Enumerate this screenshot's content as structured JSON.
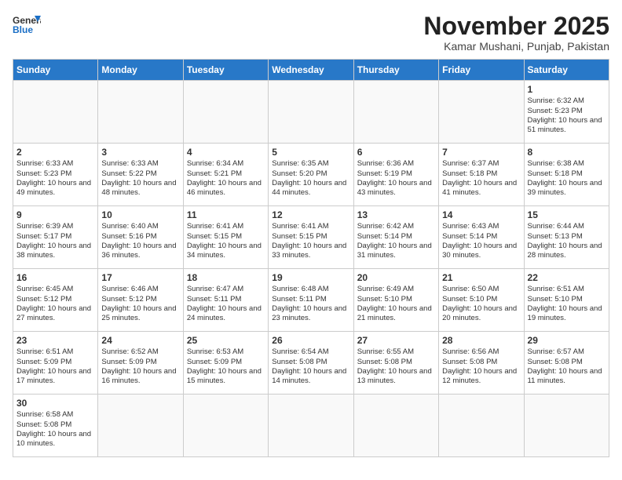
{
  "header": {
    "logo_general": "General",
    "logo_blue": "Blue",
    "title": "November 2025",
    "subtitle": "Kamar Mushani, Punjab, Pakistan"
  },
  "days_of_week": [
    "Sunday",
    "Monday",
    "Tuesday",
    "Wednesday",
    "Thursday",
    "Friday",
    "Saturday"
  ],
  "weeks": [
    [
      {
        "day": "",
        "info": ""
      },
      {
        "day": "",
        "info": ""
      },
      {
        "day": "",
        "info": ""
      },
      {
        "day": "",
        "info": ""
      },
      {
        "day": "",
        "info": ""
      },
      {
        "day": "",
        "info": ""
      },
      {
        "day": "1",
        "info": "Sunrise: 6:32 AM\nSunset: 5:23 PM\nDaylight: 10 hours and 51 minutes."
      }
    ],
    [
      {
        "day": "2",
        "info": "Sunrise: 6:33 AM\nSunset: 5:23 PM\nDaylight: 10 hours and 49 minutes."
      },
      {
        "day": "3",
        "info": "Sunrise: 6:33 AM\nSunset: 5:22 PM\nDaylight: 10 hours and 48 minutes."
      },
      {
        "day": "4",
        "info": "Sunrise: 6:34 AM\nSunset: 5:21 PM\nDaylight: 10 hours and 46 minutes."
      },
      {
        "day": "5",
        "info": "Sunrise: 6:35 AM\nSunset: 5:20 PM\nDaylight: 10 hours and 44 minutes."
      },
      {
        "day": "6",
        "info": "Sunrise: 6:36 AM\nSunset: 5:19 PM\nDaylight: 10 hours and 43 minutes."
      },
      {
        "day": "7",
        "info": "Sunrise: 6:37 AM\nSunset: 5:18 PM\nDaylight: 10 hours and 41 minutes."
      },
      {
        "day": "8",
        "info": "Sunrise: 6:38 AM\nSunset: 5:18 PM\nDaylight: 10 hours and 39 minutes."
      }
    ],
    [
      {
        "day": "9",
        "info": "Sunrise: 6:39 AM\nSunset: 5:17 PM\nDaylight: 10 hours and 38 minutes."
      },
      {
        "day": "10",
        "info": "Sunrise: 6:40 AM\nSunset: 5:16 PM\nDaylight: 10 hours and 36 minutes."
      },
      {
        "day": "11",
        "info": "Sunrise: 6:41 AM\nSunset: 5:15 PM\nDaylight: 10 hours and 34 minutes."
      },
      {
        "day": "12",
        "info": "Sunrise: 6:41 AM\nSunset: 5:15 PM\nDaylight: 10 hours and 33 minutes."
      },
      {
        "day": "13",
        "info": "Sunrise: 6:42 AM\nSunset: 5:14 PM\nDaylight: 10 hours and 31 minutes."
      },
      {
        "day": "14",
        "info": "Sunrise: 6:43 AM\nSunset: 5:14 PM\nDaylight: 10 hours and 30 minutes."
      },
      {
        "day": "15",
        "info": "Sunrise: 6:44 AM\nSunset: 5:13 PM\nDaylight: 10 hours and 28 minutes."
      }
    ],
    [
      {
        "day": "16",
        "info": "Sunrise: 6:45 AM\nSunset: 5:12 PM\nDaylight: 10 hours and 27 minutes."
      },
      {
        "day": "17",
        "info": "Sunrise: 6:46 AM\nSunset: 5:12 PM\nDaylight: 10 hours and 25 minutes."
      },
      {
        "day": "18",
        "info": "Sunrise: 6:47 AM\nSunset: 5:11 PM\nDaylight: 10 hours and 24 minutes."
      },
      {
        "day": "19",
        "info": "Sunrise: 6:48 AM\nSunset: 5:11 PM\nDaylight: 10 hours and 23 minutes."
      },
      {
        "day": "20",
        "info": "Sunrise: 6:49 AM\nSunset: 5:10 PM\nDaylight: 10 hours and 21 minutes."
      },
      {
        "day": "21",
        "info": "Sunrise: 6:50 AM\nSunset: 5:10 PM\nDaylight: 10 hours and 20 minutes."
      },
      {
        "day": "22",
        "info": "Sunrise: 6:51 AM\nSunset: 5:10 PM\nDaylight: 10 hours and 19 minutes."
      }
    ],
    [
      {
        "day": "23",
        "info": "Sunrise: 6:51 AM\nSunset: 5:09 PM\nDaylight: 10 hours and 17 minutes."
      },
      {
        "day": "24",
        "info": "Sunrise: 6:52 AM\nSunset: 5:09 PM\nDaylight: 10 hours and 16 minutes."
      },
      {
        "day": "25",
        "info": "Sunrise: 6:53 AM\nSunset: 5:09 PM\nDaylight: 10 hours and 15 minutes."
      },
      {
        "day": "26",
        "info": "Sunrise: 6:54 AM\nSunset: 5:08 PM\nDaylight: 10 hours and 14 minutes."
      },
      {
        "day": "27",
        "info": "Sunrise: 6:55 AM\nSunset: 5:08 PM\nDaylight: 10 hours and 13 minutes."
      },
      {
        "day": "28",
        "info": "Sunrise: 6:56 AM\nSunset: 5:08 PM\nDaylight: 10 hours and 12 minutes."
      },
      {
        "day": "29",
        "info": "Sunrise: 6:57 AM\nSunset: 5:08 PM\nDaylight: 10 hours and 11 minutes."
      }
    ],
    [
      {
        "day": "30",
        "info": "Sunrise: 6:58 AM\nSunset: 5:08 PM\nDaylight: 10 hours and 10 minutes."
      },
      {
        "day": "",
        "info": ""
      },
      {
        "day": "",
        "info": ""
      },
      {
        "day": "",
        "info": ""
      },
      {
        "day": "",
        "info": ""
      },
      {
        "day": "",
        "info": ""
      },
      {
        "day": "",
        "info": ""
      }
    ]
  ]
}
